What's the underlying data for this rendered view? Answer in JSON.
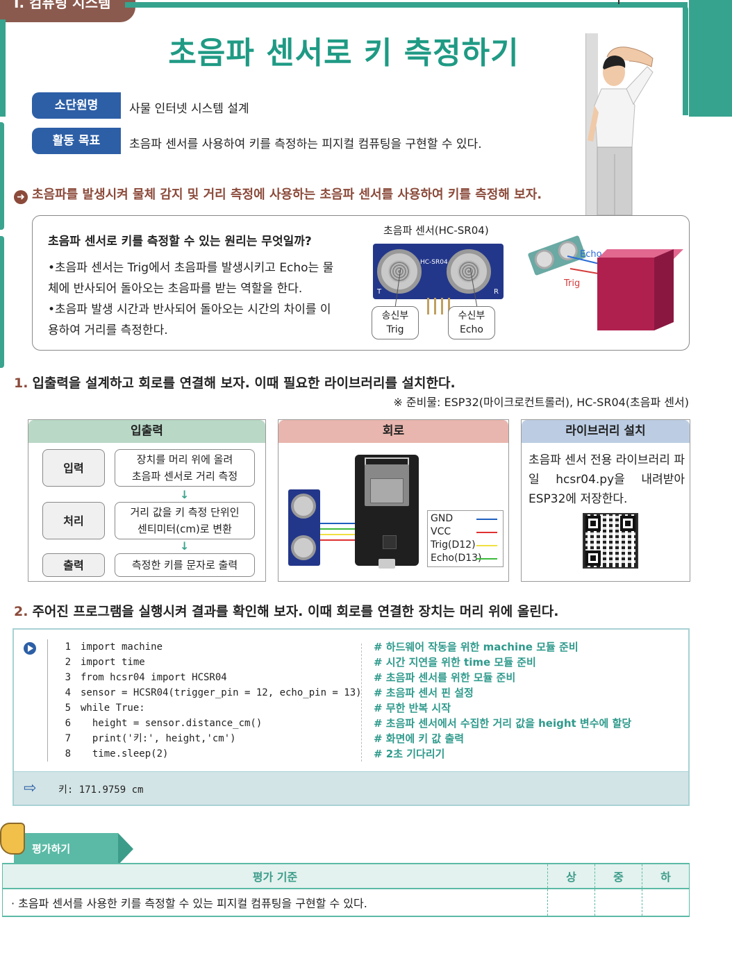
{
  "unit_tab": "I. 컴퓨팅 시스템",
  "title": "초음파 센서로 키 측정하기",
  "info": {
    "subunit_label": "소단원명",
    "subunit_value": "사물 인터넷 시스템 설계",
    "goal_label": "활동 목표",
    "goal_value": "초음파 센서를 사용하여 키를 측정하는 피지컬 컴퓨팅을 구현할 수 있다."
  },
  "intro": "초음파를 발생시켜 물체 감지 및 거리 측정에 사용하는 초음파 센서를 사용하여 키를 측정해 보자.",
  "principle": {
    "question": "초음파 센서로 키를 측정할 수 있는 원리는 무엇일까?",
    "bullets": [
      "초음파 센서는 Trig에서 초음파를 발생시키고 Echo는 물체에 반사되어 돌아오는 초음파를 받는 역할을 한다.",
      "초음파 발생 시간과 반사되어 돌아오는 시간의 차이를 이용하여 거리를 측정한다."
    ],
    "sensor_caption": "초음파 센서(HC-SR04)",
    "sensor_model": "HC-SR04",
    "board_t": "T",
    "board_r": "R",
    "callout_left": [
      "송신부",
      "Trig"
    ],
    "callout_right": [
      "수신부",
      "Echo"
    ],
    "diagram_echo": "Echo",
    "diagram_trig": "Trig"
  },
  "step1": {
    "number": "1.",
    "text": "입출력을 설계하고 회로를 연결해 보자. 이때 필요한 라이브러리를 설치한다.",
    "note": "※ 준비물: ESP32(마이크로컨트롤러), HC-SR04(초음파 센서)"
  },
  "panels": {
    "io": {
      "header": "입출력",
      "rows": [
        {
          "label": "입력",
          "lines": [
            "장치를 머리 위에 올려",
            "초음파 센서로 거리 측정"
          ]
        },
        {
          "label": "처리",
          "lines": [
            "거리 값을 키 측정 단위인",
            "센티미터(cm)로 변환"
          ]
        },
        {
          "label": "출력",
          "lines": [
            "측정한 키를 문자로 출력"
          ]
        }
      ],
      "arrow": "↓"
    },
    "circuit": {
      "header": "회로",
      "legend": [
        "GND",
        "VCC",
        "Trig(D12)",
        "Echo(D13)"
      ],
      "colors": {
        "gnd": "#1f5fbf",
        "vcc": "#e03030",
        "trig": "#f0e040",
        "echo": "#3cba3c"
      }
    },
    "library": {
      "header": "라이브러리 설치",
      "text": "초음파 센서 전용 라이브러리 파일 hcsr04.py을 내려받아 ESP32에 저장한다."
    }
  },
  "step2": {
    "number": "2.",
    "text": "주어진 프로그램을 실행시켜 결과를 확인해 보자. 이때 회로를 연결한 장치는 머리 위에 올린다."
  },
  "code": {
    "line_numbers": [
      "1",
      "2",
      "3",
      "4",
      "5",
      "6",
      "7",
      "8"
    ],
    "lines": [
      "import machine",
      "import time",
      "from hcsr04 import HCSR04",
      "sensor = HCSR04(trigger_pin = 12, echo_pin = 13)",
      "while True:",
      "  height = sensor.distance_cm()",
      "  print('키:', height,'cm')",
      "  time.sleep(2)"
    ],
    "comments": [
      "# 하드웨어 작동을 위한 machine 모듈 준비",
      "# 시간 지연을 위한 time 모듈 준비",
      "# 초음파 센서를 위한 모듈 준비",
      "# 초음파 센서 핀 설정",
      "# 무한 반복 시작",
      "# 초음파 센서에서 수집한 거리 값을 height 변수에 할당",
      "# 화면에 키 값 출력",
      "# 2초 기다리기"
    ],
    "output": "키: 171.9759 cm"
  },
  "evaluation": {
    "badge": "평가하기",
    "header": "평가 기준",
    "grades": [
      "상",
      "중",
      "하"
    ],
    "criterion": "·  초음파 센서를 사용한 키를 측정할 수 있는 피지컬 컴퓨팅을 구현할 수 있다."
  },
  "colors": {
    "accent_teal": "#1f9a84",
    "label_blue": "#2d5fa6",
    "brown": "#8b4a3a",
    "io_header": "#b9d8c6",
    "circuit_header": "#e8b6ae",
    "library_header": "#bccde3"
  }
}
